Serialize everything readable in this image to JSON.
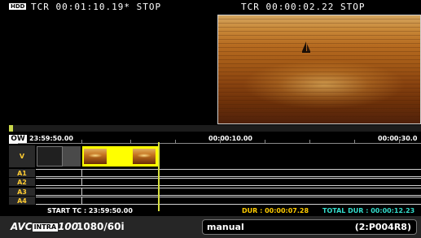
{
  "status": {
    "hdd_icon": "HDD",
    "tcr_left": "TCR 00:01:10.19* STOP",
    "tcr_right": "TCR 00:00:02.22  STOP"
  },
  "timeline": {
    "ow_label": "OW",
    "ruler_times": [
      "23:59:50.00",
      "00:00:10.00",
      "00:00:30.0"
    ],
    "tracks": [
      "V",
      "A1",
      "A2",
      "A3",
      "A4"
    ],
    "position_fraction": 0.01
  },
  "info": {
    "start_tc": "START TC : 23:59:50.00",
    "dur": "DUR : 00:00:07.28",
    "total_dur": "TOTAL DUR : 00:00:12.23"
  },
  "footer": {
    "format_logo_prefix": "AVC",
    "format_logo_box": "INTRA",
    "format_logo_suffix": "100",
    "format_text": "1080/60i",
    "mode": "manual",
    "clip_id": "(2:P004R8)"
  },
  "colors": {
    "accent_yellow": "#ffff00",
    "cursor": "#d6df3f",
    "dur_text": "#ffcc00",
    "total_dur_text": "#33ddcc",
    "track_label": "#ffcc33"
  },
  "icons": {
    "hdd": "hdd-icon",
    "boat": "sailboat-icon"
  }
}
